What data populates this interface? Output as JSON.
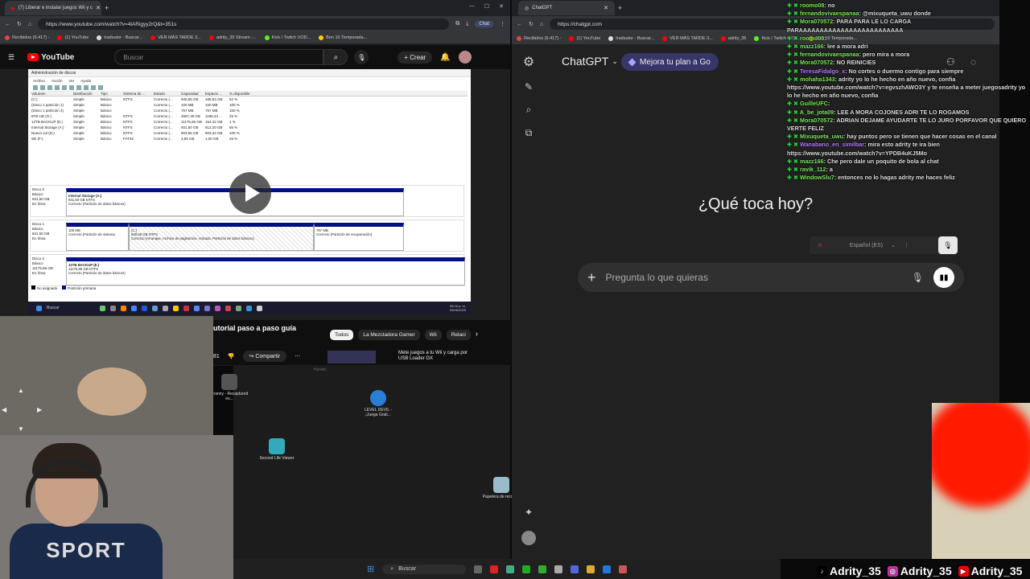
{
  "left_browser": {
    "tab_title": "(7) Liberar e instalar juegos Wii y c",
    "url": "https://www.youtube.com/watch?v=4lARigyy2rQ&t=351s",
    "chat_pill": "Chat",
    "bookmarks": [
      "Recibidos (6.417) -",
      "(1) YouTube",
      "tradsutor - Buscar...",
      "VER MÁS TARDE 3...",
      "adrity_35 Stream -...",
      "Kick / Twitch VOD...",
      "Ben 10 Temporada..."
    ],
    "youtube": {
      "logo": "YouTube",
      "search_placeholder": "Buscar",
      "create_label": "Crear"
    },
    "video": {
      "window_title": "Administración de discos",
      "menu": [
        "Archivo",
        "Acción",
        "Ver",
        "Ayuda"
      ],
      "columns": [
        "Volumen",
        "Distribución",
        "Tipo",
        "Sistema de ...",
        "Estado",
        "Capacidad",
        "Espacio ...",
        "% disponible"
      ],
      "rows": [
        [
          "(C:)",
          "Simple",
          "Básico",
          "NTFS",
          "Correcto (...",
          "930,65 GB",
          "485,53 GB",
          "52 %"
        ],
        [
          "(Disco 1 partición 1)",
          "Simple",
          "Básico",
          "",
          "Correcto (...",
          "100 MB",
          "100 MB",
          "100 %"
        ],
        [
          "(Disco 1 partición 4)",
          "Simple",
          "Básico",
          "",
          "Correcto (...",
          "767 MB",
          "767 MB",
          "100 %"
        ],
        [
          "5TB HD (G:)",
          "Simple",
          "Básico",
          "NTFS",
          "Correcto (...",
          "4657,49 GB",
          "1186,23 ...",
          "25 %"
        ],
        [
          "12TB BACKUP (E:)",
          "Simple",
          "Básico",
          "NTFS",
          "Correcto (...",
          "11175,86 GB",
          "154,42 GB",
          "1 %"
        ],
        [
          "Internal Storage (A:)",
          "Simple",
          "Básico",
          "NTFS",
          "Correcto (...",
          "931,50 GB",
          "613,20 GB",
          "66 %"
        ],
        [
          "Nuevo vol (D:)",
          "Simple",
          "Básico",
          "NTFS",
          "Correcto (...",
          "903,55 GB",
          "903,42 GB",
          "100 %"
        ],
        [
          "Wii (F:)",
          "Simple",
          "Básico",
          "FAT32",
          "Correcto (...",
          "3,89 GB",
          "1,00 GB",
          "26 %"
        ]
      ],
      "disk0": {
        "label": "Disco 0\nBásico\n931,50 GB\nEn línea",
        "part": "Internal Storage (A:)",
        "size": "931,50 GB NTFS",
        "status": "Correcto (Partición de datos básicos)"
      },
      "disk1": {
        "label": "Disco 1\nBásico\n931,50 GB\nEn línea",
        "p1size": "100 MB",
        "p1status": "Correcto (Partición de sistema",
        "p2name": "(C:)",
        "p2size": "930,65 GB NTFS",
        "p2status": "Correcto (Arranque, Archivo de paginación, Volcado, Partición de datos básicos)",
        "p3size": "767 MB",
        "p3status": "Correcto (Partición de recuperación)"
      },
      "disk2": {
        "label": "Disco 2\nBásico\n11175,86 GB\nEn línea",
        "part": "12TB BACKUP (E:)",
        "size": "11175,86 GB NTFS",
        "status": "Correcto (Partición de datos básicos)"
      },
      "legend": [
        "No asignado",
        "Partición primaria"
      ],
      "taskbar_search": "Buscar",
      "clock": "08:16 p. m.\n05/06/2025"
    },
    "below": {
      "title_fragment": "utorial paso a paso guía",
      "chips": [
        "Todos",
        "La Mezcladora Gamer",
        "Wii",
        "Relaci"
      ],
      "count_fragment": "81",
      "share": "Compartir",
      "rec_title": "Mete juegos a tu Wii y carga por USB Loader GX"
    }
  },
  "desktop": {
    "icons": [
      "Granny - Recaptured es...",
      "LEVEL DEVIL - ¡Juega Grati...",
      "Second Life Viewer",
      "Papelera de reciclaje"
    ],
    "faint_label": "Heretic"
  },
  "webcam": {
    "shirt_text": "SPORT"
  },
  "right_browser": {
    "tab_title": "ChatGPT",
    "url": "https://chatgpt.com",
    "bookmarks": [
      "Recibidos (6.417) -",
      "(1) YouTube",
      "tradsutor - Buscar...",
      "VER MÁS TARDE 3...",
      "adrity_35",
      "Kick / Twitch VOD...",
      "Ben 10 Temporada..."
    ],
    "model": "ChatGPT",
    "upgrade": "Mejora tu plan a Go",
    "headline": "¿Qué toca hoy?",
    "composer_placeholder": "Pregunta lo que quieras",
    "language": "Español (ES)"
  },
  "chat": [
    {
      "user": "roomo08",
      "text": "no",
      "color": "green"
    },
    {
      "user": "fernandovivaespanaa",
      "text": "@mixuqueta_uwu donde",
      "color": "green"
    },
    {
      "user": "Mora070572",
      "text": "PARA PARA LE LO CARGA PARAAAAAAAAAAAAAAAAAAAAAAAAA",
      "color": "green"
    },
    {
      "user": "roomo08",
      "text": "",
      "color": "green"
    },
    {
      "user": "mazz166",
      "text": "lee a mora adri",
      "color": "green"
    },
    {
      "user": "fernandovivaespanaa",
      "text": "pero mira a mora",
      "color": "green"
    },
    {
      "user": "Mora070572",
      "text": "NO REINICIES",
      "color": "green"
    },
    {
      "user": "TeresaFidalgo_x",
      "text": "No cortes o duermo contigo para siempre",
      "color": "purple"
    },
    {
      "user": "mohaha1343",
      "text": "adrity yo lo he hecho en año nuevo, confia https://www.youtube.com/watch?v=egvszhAWO3Y y te enseña a meter juegosadrity yo lo he hecho en año nuevo, confia",
      "color": "green"
    },
    {
      "user": "GuilleUFC",
      "text": "",
      "color": "green"
    },
    {
      "user": "A_be_jota09",
      "text": "LEE A MORA COJONES ADRI TE LO ROGAMOS",
      "color": "green"
    },
    {
      "user": "Mora070572",
      "text": "ADRIAN DEJAME AYUDARTE TE LO JURO PORFAVOR QUE QUIERO VERTE FELIZ",
      "color": "green"
    },
    {
      "user": "Mixuqueta_uwu",
      "text": "hay puntos pero se tienen que hacer cosas en el canal",
      "color": "green"
    },
    {
      "user": "Wanabano_en_similbar",
      "text": "mira esto adrity te ira bien https://www.youtube.com/watch?v=YPDB4uKJ5Mo",
      "color": "purple"
    },
    {
      "user": "mazz166",
      "text": "Che pero dale un poquito de bola al chat",
      "color": "green"
    },
    {
      "user": "ravik_112",
      "text": "a",
      "color": "green"
    },
    {
      "user": "WindowSlu7",
      "text": "entonces no lo hagas adrity me haces feliz",
      "color": "green"
    }
  ],
  "taskbar": {
    "search": "Buscar"
  },
  "socials": [
    "Adrity_35",
    "Adrity_35",
    "Adrity_35"
  ]
}
